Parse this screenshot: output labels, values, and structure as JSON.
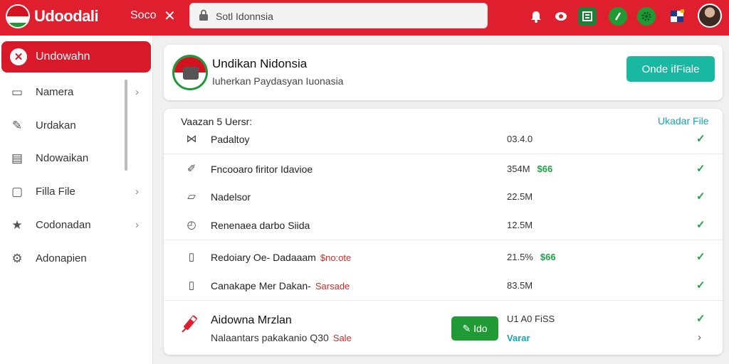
{
  "header": {
    "brand": "Udoodali",
    "link": "Soco",
    "close": "✕",
    "search_value": "Sotl Idonnsia",
    "avatar_label": "user avatar"
  },
  "sidebar": {
    "active": {
      "label": "Undowahn",
      "icon": "x-icon"
    },
    "items": [
      {
        "label": "Namera",
        "icon": "document-icon",
        "chevron": true
      },
      {
        "label": "Urdakan",
        "icon": "pencil-icon",
        "chevron": false
      },
      {
        "label": "Ndowaikan",
        "icon": "book-icon",
        "chevron": false
      },
      {
        "label": "Filla File",
        "icon": "file-icon",
        "chevron": true
      },
      {
        "label": "Codonadan",
        "icon": "star-icon",
        "chevron": true
      },
      {
        "label": "Adonapien",
        "icon": "gear-icon",
        "chevron": false
      }
    ]
  },
  "hero": {
    "title": "Undikan Nidonsia",
    "subtitle": "Iuherkan Paydasyan Iuonasia",
    "button": "Onde ifFiale"
  },
  "list": {
    "heading": "Vaazan 5 Uersr:",
    "link": "Ukadar File",
    "rows": [
      {
        "name": "Padaltoy",
        "tag": "",
        "size": "03.4.0",
        "badge": ""
      },
      {
        "name": "Fncooaro firitor Idavioe",
        "tag": "",
        "size": "354M",
        "badge": "$66"
      },
      {
        "name": "Nadelsor",
        "tag": "",
        "size": "22.5M",
        "badge": ""
      },
      {
        "name": "Renenaea darbo Siida",
        "tag": "",
        "size": "12.5M",
        "badge": ""
      },
      {
        "name": "Redoiary Oe- Dadaaam",
        "tag": "$no:ote",
        "size": "21.5%",
        "badge": "$66"
      },
      {
        "name": "Canakape Mer Dakan-",
        "tag": "Sarsade",
        "size": "83.5M",
        "badge": ""
      }
    ],
    "promo": {
      "title": "Aidowna Mrzlan",
      "subtitle": "Nalaantars pakakanio Q30",
      "tag": "Sale",
      "button": "✎ Ido",
      "meta": "U1 A0 FiSS",
      "link": "Varar"
    }
  },
  "colors": {
    "primary": "#e01f2e",
    "teal": "#19b8a3",
    "green": "#1f9a34"
  }
}
